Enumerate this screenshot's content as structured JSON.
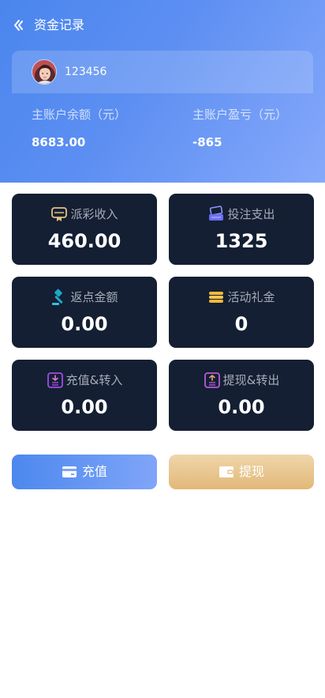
{
  "nav": {
    "title": "资金记录",
    "back_icon": "chevron-left-icon"
  },
  "user": {
    "name": "123456",
    "avatar": "user-avatar-image"
  },
  "balance": {
    "main_balance_label": "主账户余额（元）",
    "main_balance_value": "8683.00",
    "main_profit_label": "主账户盈亏（元）",
    "main_profit_value": "-865"
  },
  "stats": [
    {
      "label": "派彩收入",
      "value": "460.00",
      "icon": "award-icon",
      "color": "#e6bf7e"
    },
    {
      "label": "投注支出",
      "value": "1325",
      "icon": "wallet-card-icon",
      "color": "#6a6ff5"
    },
    {
      "label": "返点金额",
      "value": "0.00",
      "icon": "gavel-icon",
      "color": "#1da7c7"
    },
    {
      "label": "活动礼金",
      "value": "0",
      "icon": "coin-stack-icon",
      "color": "#f4b83a"
    },
    {
      "label": "充值&转入",
      "value": "0.00",
      "icon": "deposit-in-icon",
      "color": "#a04be8"
    },
    {
      "label": "提现&转出",
      "value": "0.00",
      "icon": "withdraw-out-icon",
      "color": "#b85ad6"
    }
  ],
  "actions": {
    "deposit_label": "充值",
    "withdraw_label": "提现"
  },
  "colors": {
    "header_gradient_start": "#4a86ee",
    "header_gradient_end": "#86a9fb",
    "card_background": "#141f33",
    "withdraw_gold": "#e2b878"
  }
}
